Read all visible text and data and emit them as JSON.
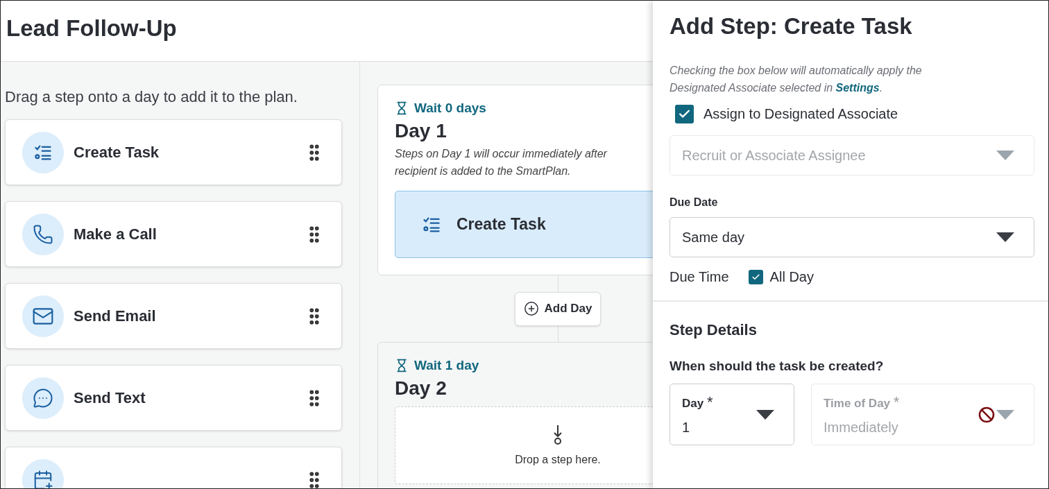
{
  "header": {
    "title": "Lead Follow-Up"
  },
  "palette": {
    "hint": "Drag a step onto a day to add it to the plan.",
    "steps": [
      {
        "kind": "task",
        "label": "Create Task"
      },
      {
        "kind": "call",
        "label": "Make a Call"
      },
      {
        "kind": "email",
        "label": "Send Email"
      },
      {
        "kind": "text",
        "label": "Send Text"
      },
      {
        "kind": "plan"
      }
    ]
  },
  "days": [
    {
      "wait": "Wait 0 days",
      "title": "Day 1",
      "note_lines": [
        "Steps on Day 1 will occur immediately after",
        "recipient is added to the SmartPlan."
      ],
      "steps": [
        {
          "kind": "task",
          "label": "Create Task"
        }
      ]
    },
    {
      "wait": "Wait 1 day",
      "title": "Day 2",
      "drop_hint": "Drop a step here."
    }
  ],
  "add_day": "Add Day",
  "drawer": {
    "title": "Add Step: Create Task",
    "info": {
      "before": "Checking the box below will automatically apply the Designated Associate selected in ",
      "link": "Settings",
      "after": "."
    },
    "assign": {
      "label": "Assign to Designated Associate",
      "checked": true
    },
    "assignee": {
      "placeholder": "Recruit or Associate Assignee",
      "disabled": true
    },
    "due_date": {
      "label": "Due Date",
      "value": "Same day"
    },
    "due_time": {
      "label": "Due Time",
      "all_day": {
        "label": "All Day",
        "checked": true
      }
    },
    "step_details": {
      "title": "Step Details",
      "question": "When should the task be created?",
      "fields": [
        {
          "label": "Day",
          "mark": "*",
          "value": "1",
          "disabled": false
        },
        {
          "label": "Time of Day",
          "mark": "*",
          "value": "Immediately",
          "disabled": true
        }
      ]
    }
  }
}
